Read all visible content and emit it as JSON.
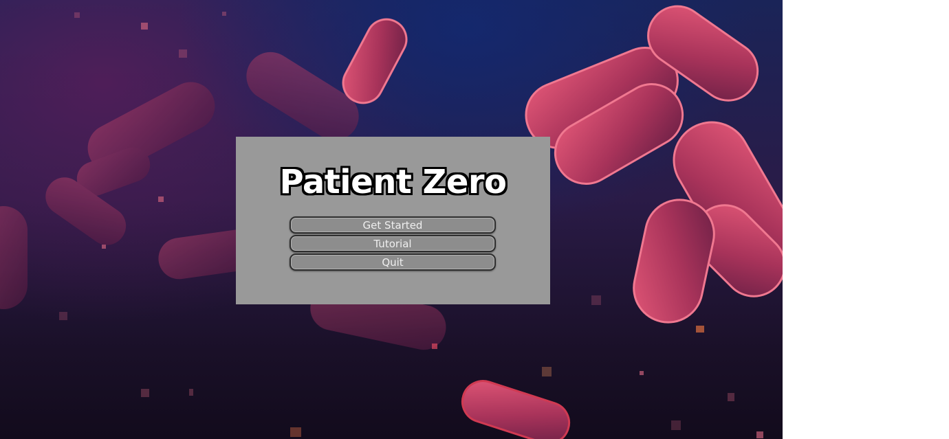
{
  "screen": {
    "background_image": "bacteria-illustration",
    "colors": {
      "panel": "#999999",
      "button_fill": "#8d8d8d",
      "button_border": "#2e2e2e",
      "button_text": "#efefef",
      "title_fill": "#ffffff",
      "title_outline": "#000000",
      "bacteria": "#d2445e"
    }
  },
  "menu": {
    "title": "Patient Zero",
    "buttons": [
      {
        "label": "Get Started"
      },
      {
        "label": "Tutorial"
      },
      {
        "label": "Quit"
      }
    ]
  }
}
